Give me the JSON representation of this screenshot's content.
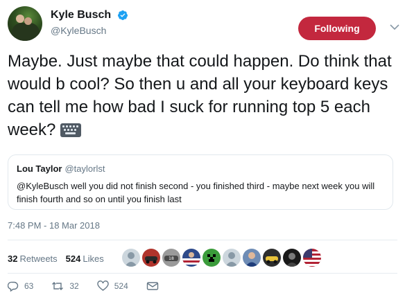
{
  "author": {
    "display_name": "Kyle Busch",
    "handle": "@KyleBusch",
    "verified": true
  },
  "follow_button": {
    "label": "Following",
    "color": "#c3283e"
  },
  "tweet": {
    "text": "Maybe. Just maybe that could happen. Do think that would b cool? So then u and all your keyboard keys can tell me how bad I suck for running top 5 each week?",
    "emoji": "keyboard-emoji"
  },
  "quoted_tweet": {
    "display_name": "Lou Taylor",
    "handle": "@taylorlst",
    "text": "@KyleBusch well you did not finish second - you finished third - maybe next week you will finish fourth and so on until you finish last"
  },
  "timestamp": "7:48 PM - 18 Mar 2018",
  "stats": {
    "retweets_count": "32",
    "retweets_label": "Retweets",
    "likes_count": "524",
    "likes_label": "Likes"
  },
  "likers": [
    {
      "icon": "default-avatar-icon",
      "color": "#a8b5c0"
    },
    {
      "icon": "car-avatar-icon",
      "color": "#b0342c"
    },
    {
      "icon": "car-avatar-icon",
      "color": "#4a4a4a"
    },
    {
      "icon": "flag-avatar-icon",
      "color": "#2e4a8a"
    },
    {
      "icon": "creeper-avatar-icon",
      "color": "#3b9c3b"
    },
    {
      "icon": "default-avatar-icon",
      "color": "#a8b5c0"
    },
    {
      "icon": "person-avatar-icon",
      "color": "#6e8cb5"
    },
    {
      "icon": "car-avatar-icon",
      "color": "#2d2d2d"
    },
    {
      "icon": "person-avatar-icon",
      "color": "#1a1a1a"
    },
    {
      "icon": "flag-avatar-icon",
      "color": "#b22234"
    }
  ],
  "actions": {
    "reply_count": "63",
    "retweet_count": "32",
    "like_count": "524"
  }
}
